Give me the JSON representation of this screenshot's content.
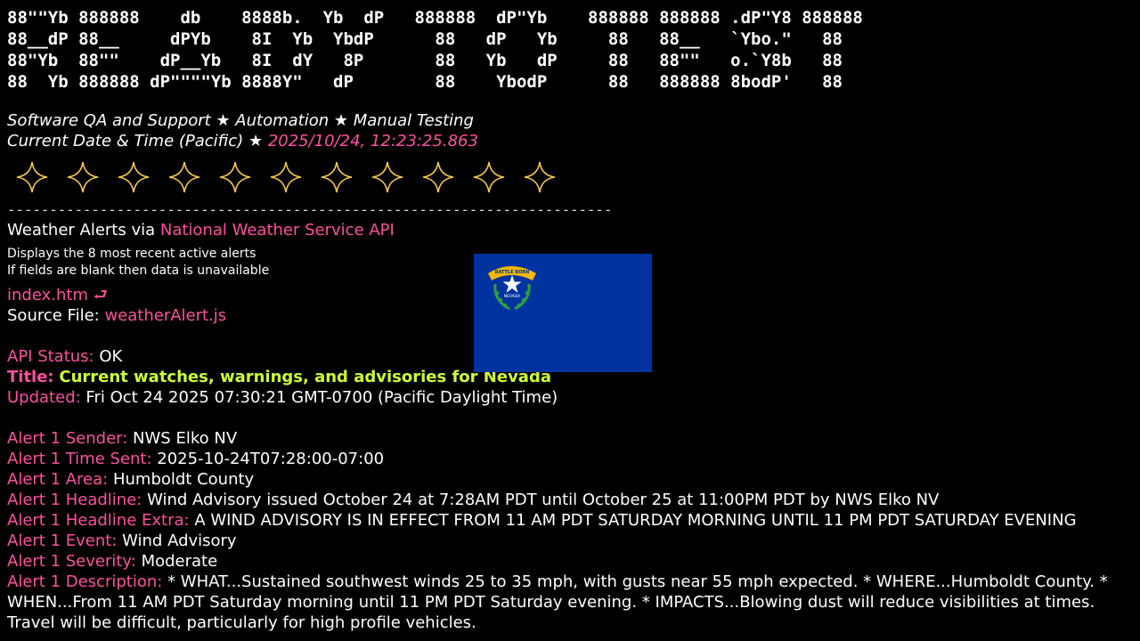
{
  "banner": {
    "lines": [
      "88\"\"Yb 888888    db    8888b.  Yb  dP   888888  dP\"Yb    888888 888888 .dP\"Y8 888888",
      "88__dP 88__     dPYb    8I  Yb  YbdP      88   dP   Yb     88   88__   `Ybo.\"   88",
      "88\"Yb  88\"\"    dP__Yb   8I  dY   8P       88   Yb   dP     88   88\"\"   o.`Y8b   88",
      "88  Yb 888888 dP\"\"\"\"Yb 8888Y\"   dP        88    YbodP      88   888888 8bodP'   88"
    ]
  },
  "tagline": "Software QA and Support ★ Automation ★ Manual Testing",
  "datetime": {
    "label": "Current Date & Time (Pacific) ★",
    "value": "2025/10/24, 12:23:25.863"
  },
  "stars": {
    "count": 11,
    "color": "#f5c84a"
  },
  "divider": "------------------------------------------------------------------------",
  "section": {
    "title_prefix": "Weather Alerts via",
    "title_link": "National Weather Service API",
    "note1": "Displays the 8 most recent active alerts",
    "note2": "If fields are blank then data is unavailable",
    "index_link": "index.htm ⮐",
    "source_label": "Source File:",
    "source_link": "weatherAlert.js"
  },
  "status": {
    "api_label": "API Status:",
    "api_value": "OK",
    "title_label": "Title:",
    "title_value": "Current watches, warnings, and advisories for Nevada",
    "updated_label": "Updated:",
    "updated_value": "Fri Oct 24 2025 07:30:21 GMT-0700 (Pacific Daylight Time)"
  },
  "flag": {
    "motto": "BATTLE BORN",
    "state": "NEVADA",
    "color": "#0033a0"
  },
  "alert1": {
    "sender_label": "Alert 1 Sender:",
    "sender": "NWS Elko NV",
    "time_label": "Alert 1 Time Sent:",
    "time": "2025-10-24T07:28:00-07:00",
    "area_label": "Alert 1 Area:",
    "area": "Humboldt County",
    "headline_label": "Alert 1 Headline:",
    "headline": "Wind Advisory issued October 24 at 7:28AM PDT until October 25 at 11:00PM PDT by NWS Elko NV",
    "extra_label": "Alert 1 Headline Extra:",
    "extra": "A WIND ADVISORY IS IN EFFECT FROM 11 AM PDT SATURDAY MORNING UNTIL 11 PM PDT SATURDAY EVENING",
    "event_label": "Alert 1 Event:",
    "event": "Wind Advisory",
    "severity_label": "Alert 1 Severity:",
    "severity": "Moderate",
    "desc_label": "Alert 1 Description:",
    "desc": "* WHAT...Sustained southwest winds 25 to 35 mph, with gusts near 55 mph expected. * WHERE...Humboldt County. * WHEN...From 11 AM PDT Saturday morning until 11 PM PDT Saturday evening. * IMPACTS...Blowing dust will reduce visibilities at times. Travel will be difficult, particularly for high profile vehicles."
  }
}
